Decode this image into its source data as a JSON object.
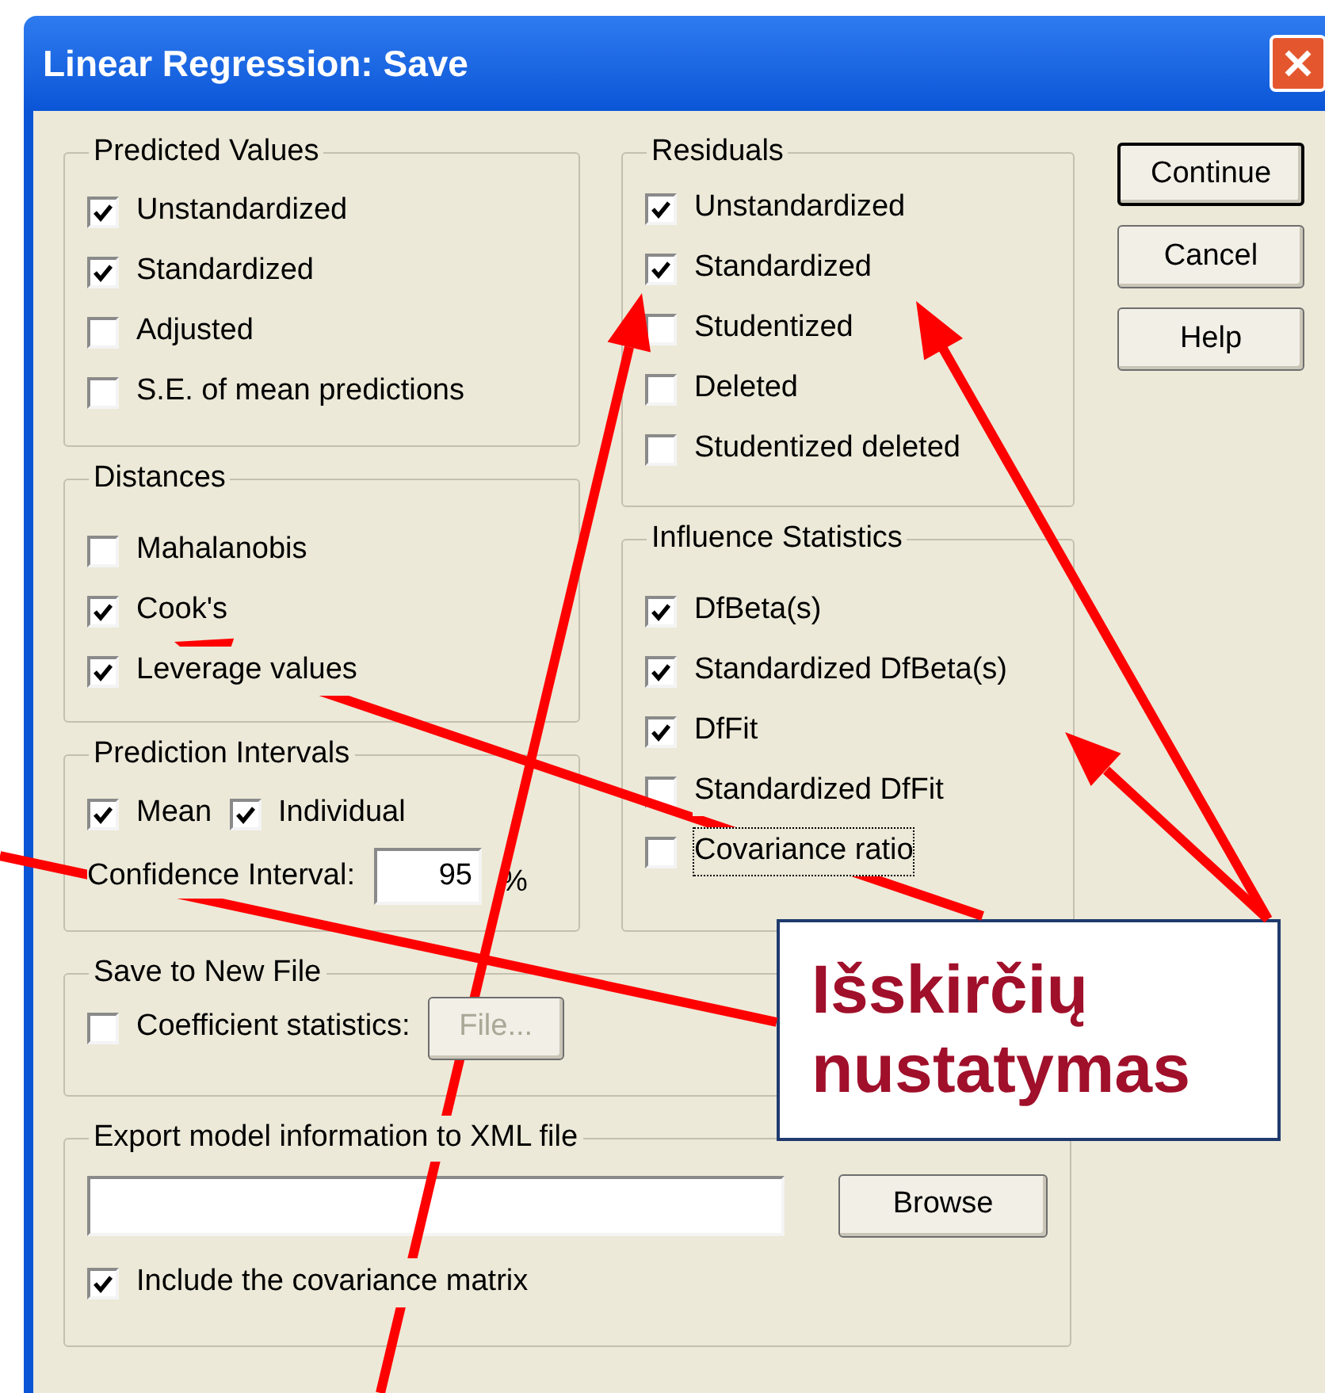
{
  "window": {
    "title": "Linear Regression: Save"
  },
  "predicted_values": {
    "title": "Predicted Values",
    "options": [
      {
        "label": "Unstandardized",
        "checked": true
      },
      {
        "label": "Standardized",
        "checked": true
      },
      {
        "label": "Adjusted",
        "checked": false
      },
      {
        "label": "S.E. of mean predictions",
        "checked": false
      }
    ]
  },
  "distances": {
    "title": "Distances",
    "options": [
      {
        "label": "Mahalanobis",
        "checked": false
      },
      {
        "label": "Cook's",
        "checked": true
      },
      {
        "label": "Leverage values",
        "checked": true
      }
    ]
  },
  "prediction_intervals": {
    "title": "Prediction Intervals",
    "options": [
      {
        "label": "Mean",
        "checked": true
      },
      {
        "label": "Individual",
        "checked": true
      }
    ],
    "confidence_label": "Confidence Interval:",
    "confidence_value": "95",
    "unit": "%"
  },
  "residuals": {
    "title": "Residuals",
    "options": [
      {
        "label": "Unstandardized",
        "checked": true
      },
      {
        "label": "Standardized",
        "checked": true
      },
      {
        "label": "Studentized",
        "checked": false
      },
      {
        "label": "Deleted",
        "checked": false
      },
      {
        "label": "Studentized deleted",
        "checked": false
      }
    ]
  },
  "influence_statistics": {
    "title": "Influence Statistics",
    "options": [
      {
        "label": "DfBeta(s)",
        "checked": true,
        "focused": false
      },
      {
        "label": "Standardized DfBeta(s)",
        "checked": true,
        "focused": false
      },
      {
        "label": "DfFit",
        "checked": true,
        "focused": false
      },
      {
        "label": "Standardized DfFit",
        "checked": false,
        "focused": false
      },
      {
        "label": "Covariance ratio",
        "checked": false,
        "focused": true
      }
    ]
  },
  "buttons": [
    {
      "label": "Continue",
      "default": true
    },
    {
      "label": "Cancel",
      "default": false
    },
    {
      "label": "Help",
      "default": false
    }
  ],
  "save_to_new_file": {
    "title": "Save to New File",
    "option": {
      "label": "Coefficient statistics:",
      "checked": false
    },
    "file_button": {
      "label": "File...",
      "disabled": true
    }
  },
  "export": {
    "title": "Export model information to XML file",
    "browse_button": "Browse",
    "option": {
      "label": "Include the covariance matrix",
      "checked": true
    }
  },
  "annotation": {
    "text": "Išskirčių nustatymas"
  }
}
